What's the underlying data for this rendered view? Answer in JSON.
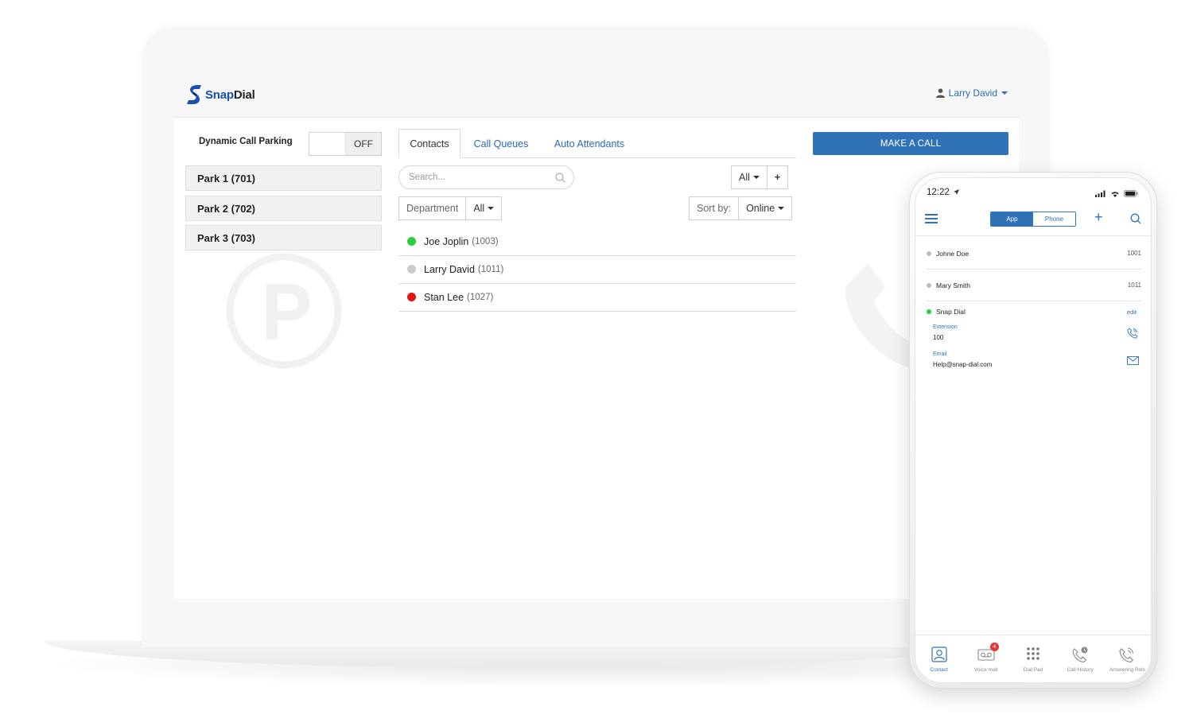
{
  "app": {
    "brand_part1": "Snap",
    "brand_part2": "Dial",
    "user_name": "Larry David",
    "accent_color": "#2f72b8"
  },
  "parking": {
    "label": "Dynamic Call Parking",
    "toggle_state": "OFF",
    "slots": [
      {
        "label": "Park 1 (701)"
      },
      {
        "label": "Park 2 (702)"
      },
      {
        "label": "Park 3 (703)"
      }
    ]
  },
  "tabs": [
    {
      "label": "Contacts",
      "active": true
    },
    {
      "label": "Call Queues",
      "active": false
    },
    {
      "label": "Auto Attendants",
      "active": false
    }
  ],
  "search": {
    "placeholder": "Search..."
  },
  "filter": {
    "value": "All"
  },
  "department": {
    "label": "Department",
    "value": "All"
  },
  "sort": {
    "label": "Sort by:",
    "value": "Online"
  },
  "contacts": [
    {
      "name": "Joe Joplin",
      "ext": "(1003)",
      "status": "online",
      "status_color": "#2ecc40"
    },
    {
      "name": "Larry David",
      "ext": "(1011)",
      "status": "offline",
      "status_color": "#cccccc"
    },
    {
      "name": "Stan Lee",
      "ext": "(1027)",
      "status": "busy",
      "status_color": "#e01515"
    }
  ],
  "make_call_label": "MAKE A CALL",
  "mobile": {
    "time": "12:22",
    "segments": {
      "app": "App",
      "phone": "Phone"
    },
    "contacts": [
      {
        "name": "Johne Doe",
        "ext": "1001"
      },
      {
        "name": "Mary Smith",
        "ext": "1011"
      }
    ],
    "expanded": {
      "name": "Snap Dial",
      "edit_label": "edit",
      "extension_label": "Extension",
      "extension_value": "100",
      "email_label": "Email",
      "email_value": "Help@snap-dial.com"
    },
    "tabbar": [
      {
        "label": "Contact",
        "icon": "contact-icon",
        "active": true
      },
      {
        "label": "Voice mail",
        "icon": "voicemail-icon",
        "badge": "4"
      },
      {
        "label": "Dial Pad",
        "icon": "dialpad-icon"
      },
      {
        "label": "Call History",
        "icon": "call-history-icon"
      },
      {
        "label": "Answering Ruls",
        "icon": "answering-rules-icon"
      }
    ]
  }
}
